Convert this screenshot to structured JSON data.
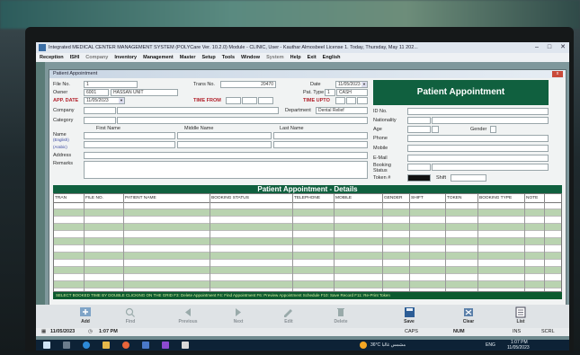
{
  "window": {
    "title": "Integrated MEDICAL CENTER MANAGEMENT SYSTEM (POLYCare Ver. 10.2.0) Module - CLINIC, User - Kauthar Almosbeel License 1. Today, Thursday, May 11 202..."
  },
  "menu": [
    "Reception",
    "ISHI",
    "Company",
    "Inventory",
    "Management",
    "Master",
    "Setup",
    "Tools",
    "Window",
    "System",
    "Help",
    "Exit",
    "English"
  ],
  "form_window": {
    "title": "Patient Appointment",
    "close_label": "x"
  },
  "form": {
    "file_no_label": "File No.",
    "file_no_value": "1",
    "owner_label": "Owner",
    "owner_code": "6001",
    "owner_name": "HASSAN UNIT",
    "appt_date_label": "APP. DATE",
    "appt_date_value": "11/05/2023",
    "trans_no_label": "Trans No.",
    "trans_no_value": "20470",
    "date_label": "Date",
    "date_value": "11/05/2023",
    "pat_type_label": "Pat. Type",
    "pat_type_code": "1",
    "pat_type_value": "CASH",
    "time_from_label": "TIME FROM",
    "time_upto_label": "TIME UPTO",
    "department_label": "Department",
    "department_value": "Dental Relief",
    "company_label": "Company",
    "category_label": "Category",
    "first_name_label": "First Name",
    "middle_name_label": "Middle Name",
    "last_name_label": "Last Name",
    "name_label": "Name",
    "name_english_hint": "(English)",
    "name_arabic_hint": "(Arabic)",
    "address_label": "Address",
    "remarks_label": "Remarks"
  },
  "panel": {
    "title": "Patient Appointment",
    "id_no_label": "ID No.",
    "nationality_label": "Nationality",
    "age_label": "Age",
    "gender_label": "Gender",
    "phone_label": "Phone",
    "mobile_label": "Mobile",
    "email_label": "E-Mail",
    "booking_status_label": "Booking Status",
    "token_label": "Token #",
    "shift_label": "Shift"
  },
  "details": {
    "title": "Patient Appointment - Details",
    "columns": [
      "TRAN",
      "FILE NO.",
      "PATIENT NAME",
      "BOOKING STATUS",
      "TELEPHONE",
      "MOBILE",
      "GENDER",
      "SHIFT",
      "TOKEN",
      "BOOKING TYPE",
      "NOTE"
    ],
    "row_count": 12
  },
  "hint_bar": "SELECT BOOKED TIME BY DOUBLE CLICKING ON THE GRID   F3: Delete Appointment   F4: Find Appointment   F6: Preview Appointment Schedule   F10: Save Record   F11: Re-Print Token",
  "toolbar": {
    "buttons": [
      {
        "label": "Add",
        "icon": "add-icon",
        "enabled": true
      },
      {
        "label": "Find",
        "icon": "find-icon",
        "enabled": false
      },
      {
        "label": "Previous",
        "icon": "previous-icon",
        "enabled": false
      },
      {
        "label": "Next",
        "icon": "next-icon",
        "enabled": false
      },
      {
        "label": "Edit",
        "icon": "edit-icon",
        "enabled": false
      },
      {
        "label": "Delete",
        "icon": "delete-icon",
        "enabled": false
      },
      {
        "label": "Save",
        "icon": "save-icon",
        "enabled": true
      },
      {
        "label": "Clear",
        "icon": "clear-icon",
        "enabled": true
      },
      {
        "label": "List",
        "icon": "list-icon",
        "enabled": true
      }
    ]
  },
  "statusbar": {
    "date": "11/05/2023",
    "time": "1:07 PM",
    "caps": "CAPS",
    "num": "NUM",
    "ins": "INS",
    "scrl": "SCRL"
  },
  "taskbar": {
    "weather": "36°C مشمس غالبا",
    "lang": "ENG",
    "clock_time": "1:07 PM",
    "clock_date": "11/05/2023"
  },
  "colors": {
    "accent": "#10603f",
    "label_red": "#b2222c"
  }
}
